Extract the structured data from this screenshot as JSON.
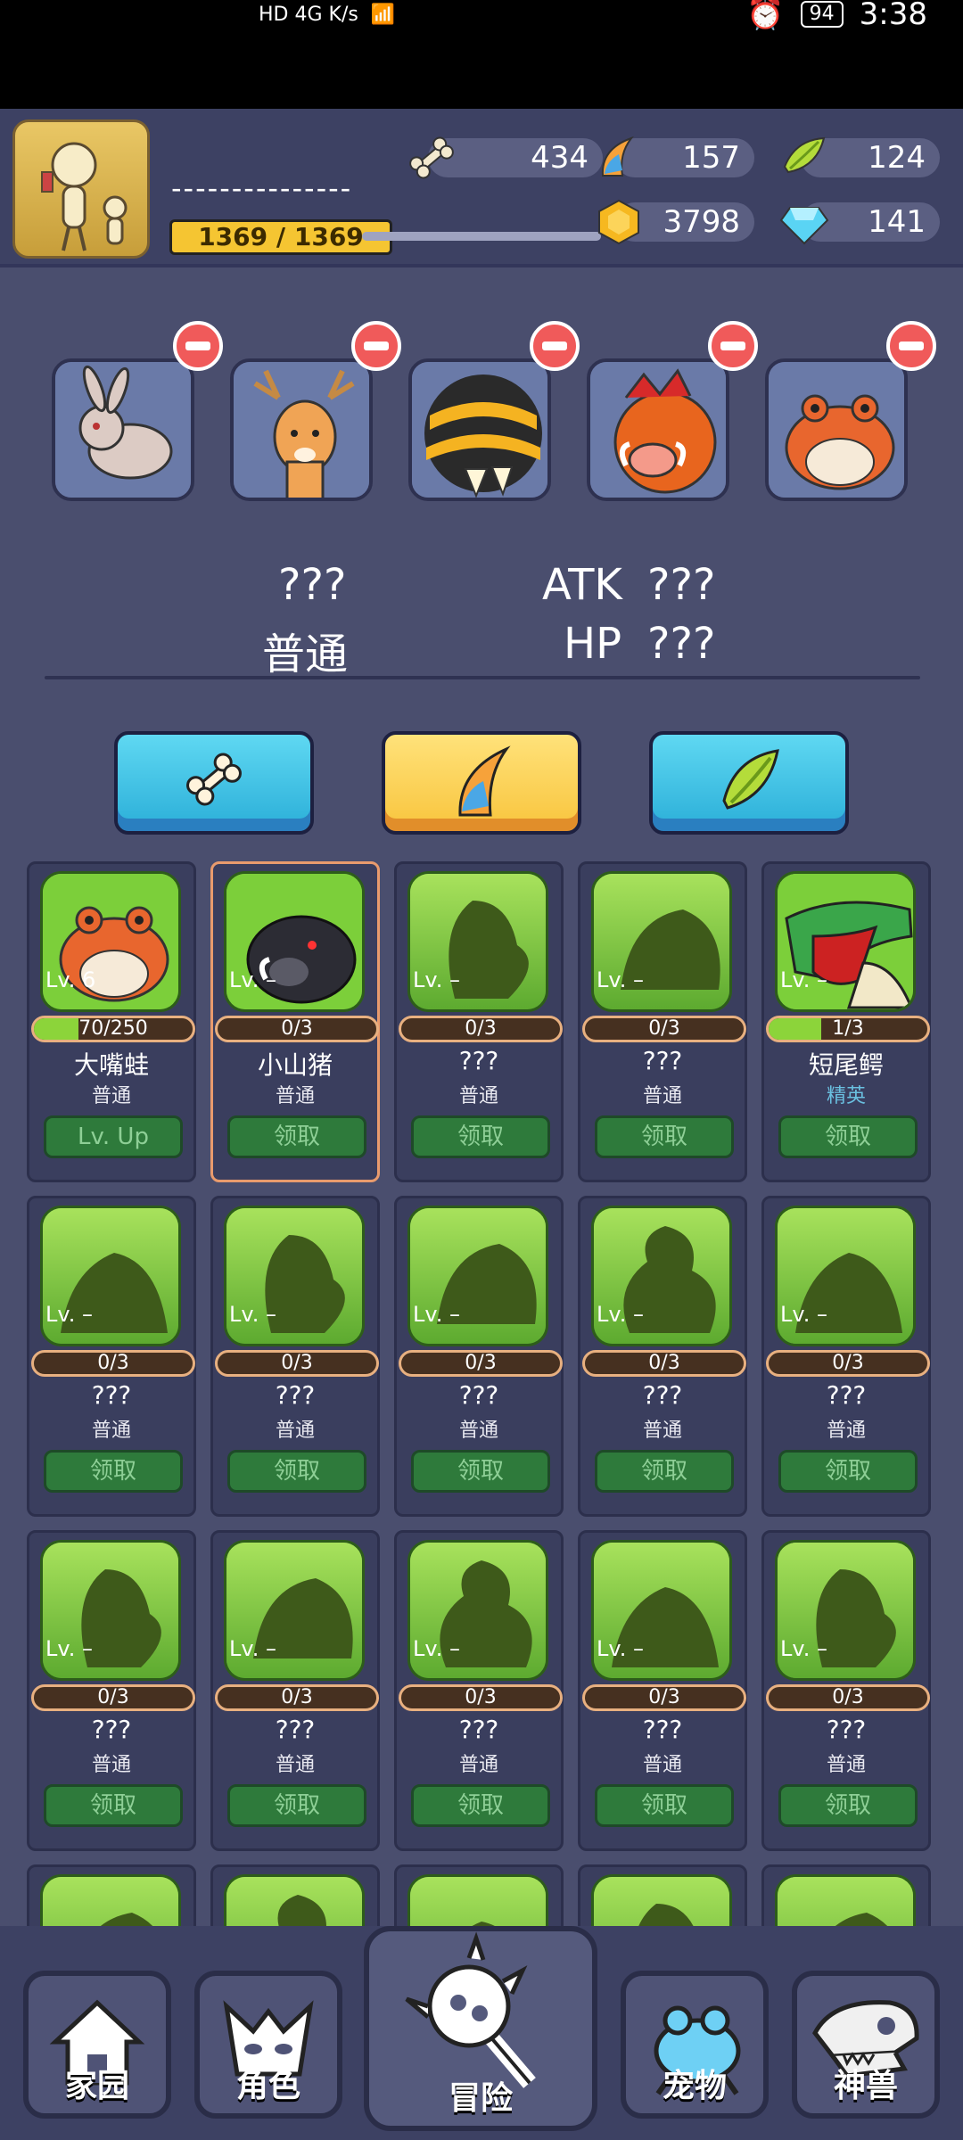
{
  "status_bar": {
    "left": "HD  4G  K/s",
    "battery": "94",
    "time": "3:38"
  },
  "player": {
    "name": "---------------",
    "hp": "1369 / 1369"
  },
  "resources": {
    "bone": "434",
    "claw": "157",
    "leaf": "124",
    "gold": "3798",
    "gem": "141"
  },
  "selected_pets": [
    {
      "icon": "rabbit-icon"
    },
    {
      "icon": "deer-icon"
    },
    {
      "icon": "bee-icon"
    },
    {
      "icon": "boar-icon"
    },
    {
      "icon": "frog-icon"
    }
  ],
  "pet_info": {
    "name": "???",
    "rarity": "普通",
    "atk_label": "ATK",
    "atk_value": "???",
    "hp_label": "HP",
    "hp_value": "???"
  },
  "tabs": [
    {
      "icon": "bone-icon",
      "active": false
    },
    {
      "icon": "claw-icon",
      "active": true
    },
    {
      "icon": "leaf-icon",
      "active": false
    }
  ],
  "pets": [
    {
      "lv": "Lv. 6",
      "progress": "70/250",
      "name": "大嘴蛙",
      "rarity": "普通",
      "button": "Lv. Up",
      "fill": 0.28,
      "kind": "frog"
    },
    {
      "lv": "Lv. –",
      "progress": "0/3",
      "name": "小山猪",
      "rarity": "普通",
      "button": "领取",
      "fill": 0,
      "kind": "boar"
    },
    {
      "lv": "Lv. –",
      "progress": "0/3",
      "name": "???",
      "rarity": "普通",
      "button": "领取",
      "fill": 0,
      "kind": "shadow"
    },
    {
      "lv": "Lv. –",
      "progress": "0/3",
      "name": "???",
      "rarity": "普通",
      "button": "领取",
      "fill": 0,
      "kind": "shadow"
    },
    {
      "lv": "Lv. –",
      "progress": "1/3",
      "name": "短尾鳄",
      "rarity": "精英",
      "button": "领取",
      "fill": 0.33,
      "kind": "croc"
    },
    {
      "lv": "Lv. –",
      "progress": "0/3",
      "name": "???",
      "rarity": "普通",
      "button": "领取",
      "fill": 0,
      "kind": "shadow"
    },
    {
      "lv": "Lv. –",
      "progress": "0/3",
      "name": "???",
      "rarity": "普通",
      "button": "领取",
      "fill": 0,
      "kind": "shadow"
    },
    {
      "lv": "Lv. –",
      "progress": "0/3",
      "name": "???",
      "rarity": "普通",
      "button": "领取",
      "fill": 0,
      "kind": "shadow"
    },
    {
      "lv": "Lv. –",
      "progress": "0/3",
      "name": "???",
      "rarity": "普通",
      "button": "领取",
      "fill": 0,
      "kind": "shadow"
    },
    {
      "lv": "Lv. –",
      "progress": "0/3",
      "name": "???",
      "rarity": "普通",
      "button": "领取",
      "fill": 0,
      "kind": "shadow"
    },
    {
      "lv": "Lv. –",
      "progress": "0/3",
      "name": "???",
      "rarity": "普通",
      "button": "领取",
      "fill": 0,
      "kind": "shadow"
    },
    {
      "lv": "Lv. –",
      "progress": "0/3",
      "name": "???",
      "rarity": "普通",
      "button": "领取",
      "fill": 0,
      "kind": "shadow"
    },
    {
      "lv": "Lv. –",
      "progress": "0/3",
      "name": "???",
      "rarity": "普通",
      "button": "领取",
      "fill": 0,
      "kind": "shadow"
    },
    {
      "lv": "Lv. –",
      "progress": "0/3",
      "name": "???",
      "rarity": "普通",
      "button": "领取",
      "fill": 0,
      "kind": "shadow"
    },
    {
      "lv": "Lv. –",
      "progress": "0/3",
      "name": "???",
      "rarity": "普通",
      "button": "领取",
      "fill": 0,
      "kind": "shadow"
    },
    {
      "lv": "",
      "progress": "",
      "name": "",
      "rarity": "",
      "button": "",
      "fill": 0,
      "kind": "shadow"
    },
    {
      "lv": "",
      "progress": "",
      "name": "",
      "rarity": "",
      "button": "",
      "fill": 0,
      "kind": "shadow"
    },
    {
      "lv": "",
      "progress": "",
      "name": "",
      "rarity": "",
      "button": "",
      "fill": 0,
      "kind": "shadow"
    },
    {
      "lv": "",
      "progress": "",
      "name": "",
      "rarity": "",
      "button": "",
      "fill": 0,
      "kind": "shadow"
    },
    {
      "lv": "",
      "progress": "",
      "name": "",
      "rarity": "",
      "button": "",
      "fill": 0,
      "kind": "shadow"
    }
  ],
  "nav": [
    {
      "label": "家园",
      "icon": "home-icon"
    },
    {
      "label": "角色",
      "icon": "character-icon"
    },
    {
      "label": "冒险",
      "icon": "adventure-icon"
    },
    {
      "label": "宠物",
      "icon": "pet-icon"
    },
    {
      "label": "神兽",
      "icon": "beast-icon"
    }
  ],
  "colors": {
    "bg": "#4a4e6e",
    "panel": "#3d4163",
    "accent_yellow": "#f8c43c",
    "accent_blue": "#2aaed8",
    "claim_green": "#2e7a3b"
  }
}
